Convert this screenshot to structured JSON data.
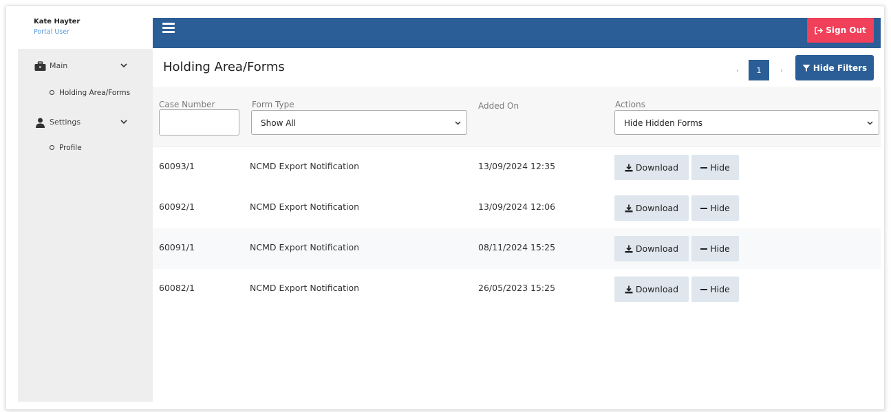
{
  "user": {
    "name": "Kate Hayter",
    "role": "Portal User"
  },
  "sidebar": {
    "groups": [
      {
        "label": "Main",
        "icon": "briefcase-icon",
        "items": [
          "Holding Area/Forms"
        ]
      },
      {
        "label": "Settings",
        "icon": "user-icon",
        "items": [
          "Profile"
        ]
      }
    ]
  },
  "topbar": {
    "sign_out_label": "Sign Out"
  },
  "page": {
    "title": "Holding Area/Forms"
  },
  "pager": {
    "current": "1",
    "prev_glyph": "‹",
    "next_glyph": "›"
  },
  "hide_filters_label": "Hide Filters",
  "filters": {
    "case_number_label": "Case Number",
    "case_number_value": "",
    "form_type_label": "Form Type",
    "form_type_value": "Show All",
    "added_on_label": "Added On",
    "actions_label": "Actions",
    "actions_value": "Hide Hidden Forms"
  },
  "rows": [
    {
      "case": "60093/1",
      "form": "NCMD Export Notification",
      "added": "13/09/2024 12:35"
    },
    {
      "case": "60092/1",
      "form": "NCMD Export Notification",
      "added": "13/09/2024 12:06"
    },
    {
      "case": "60091/1",
      "form": "NCMD Export Notification",
      "added": "08/11/2024 15:25"
    },
    {
      "case": "60082/1",
      "form": "NCMD Export Notification",
      "added": "26/05/2023 15:25"
    }
  ],
  "row_actions": {
    "download_label": "Download",
    "hide_label": "Hide"
  },
  "colors": {
    "primary": "#2b5e96",
    "danger": "#f0405a",
    "sidebar_bg": "#eeeeee",
    "action_btn_bg": "#dfe6ee"
  }
}
